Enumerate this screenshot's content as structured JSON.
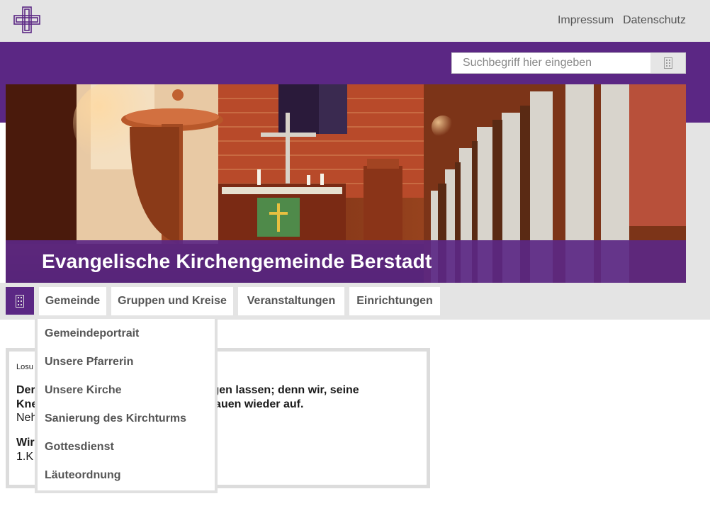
{
  "topbar": {
    "links": [
      "Impressum",
      "Datenschutz"
    ]
  },
  "search": {
    "placeholder": "Suchbegriff hier eingeben"
  },
  "hero": {
    "title": "Evangelische Kirchengemeinde Berstadt"
  },
  "nav": {
    "items": [
      "Gemeinde",
      "Gruppen und Kreise",
      "Veranstaltungen",
      "Einrichtungen"
    ]
  },
  "dropdown": {
    "items": [
      "Gemeindeportrait",
      "Unsere Pfarrerin",
      "Unsere Kirche",
      "Sanierung des Kirchturms",
      "Gottesdienst",
      "Läuteordnung"
    ]
  },
  "losung": {
    "label": "Losu",
    "verse_line1": "Der                                                    lingen lassen; denn wir, seine",
    "verse_line2": "Kne                                                    l bauen wieder auf.",
    "ref1": "Neh",
    "verse2": "Wir",
    "ref2": "1.K"
  },
  "colors": {
    "brand_purple": "#5b2784",
    "gray_bar": "#e4e4e4"
  }
}
